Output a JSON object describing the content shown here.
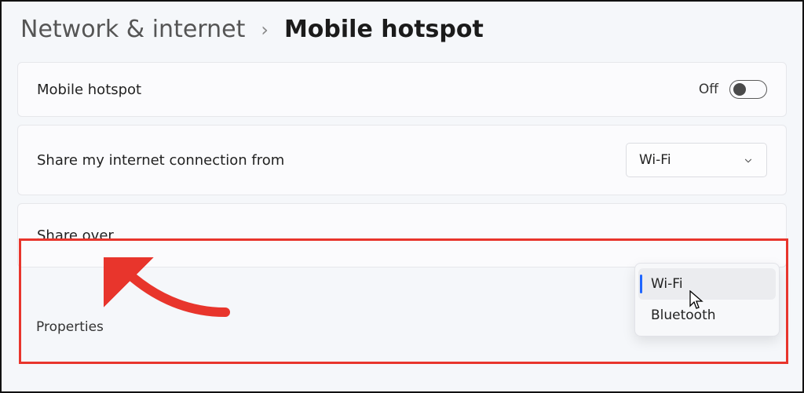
{
  "breadcrumb": {
    "parent": "Network & internet",
    "current": "Mobile hotspot"
  },
  "cards": {
    "hotspot": {
      "label": "Mobile hotspot",
      "state_text": "Off"
    },
    "share_from": {
      "label": "Share my internet connection from",
      "selected": "Wi-Fi"
    },
    "share_over": {
      "label": "Share over",
      "options": [
        "Wi-Fi",
        "Bluetooth"
      ],
      "selected_index": 0
    },
    "properties": {
      "label": "Properties"
    }
  },
  "dropdown": {
    "item0": "Wi-Fi",
    "item1": "Bluetooth"
  },
  "annotations": {
    "arrow_color": "#e8352c",
    "highlight_color": "#e8352c"
  }
}
